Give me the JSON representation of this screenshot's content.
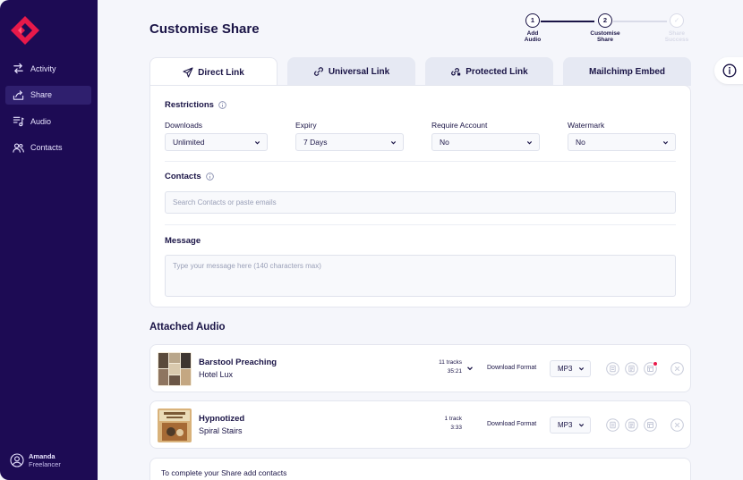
{
  "sidebar": {
    "items": [
      {
        "label": "Activity",
        "icon": "arrows-swap-icon"
      },
      {
        "label": "Share",
        "icon": "share-upload-icon",
        "active": true
      },
      {
        "label": "Audio",
        "icon": "audio-playlist-icon"
      },
      {
        "label": "Contacts",
        "icon": "users-icon"
      }
    ],
    "user": {
      "name": "Amanda",
      "role": "Freelancer"
    },
    "colors": {
      "background": "#1d0b54",
      "active": "#2f1f6e",
      "logo": "#e8194a"
    }
  },
  "header": {
    "title": "Customise Share",
    "steps": [
      {
        "number": "1",
        "label_line1": "Add",
        "label_line2": "Audio",
        "state": "done"
      },
      {
        "number": "2",
        "label_line1": "Customise",
        "label_line2": "Share",
        "state": "current"
      },
      {
        "number": "✓",
        "label_line1": "Share",
        "label_line2": "Success",
        "state": "todo"
      }
    ]
  },
  "tabs": [
    {
      "label": "Direct Link",
      "icon": "paper-plane-icon",
      "active": true
    },
    {
      "label": "Universal Link",
      "icon": "link-icon"
    },
    {
      "label": "Protected Link",
      "icon": "locked-link-icon"
    },
    {
      "label": "Mailchimp Embed",
      "icon": ""
    }
  ],
  "restrictions": {
    "title": "Restrictions",
    "downloads": {
      "label": "Downloads",
      "value": "Unlimited"
    },
    "expiry": {
      "label": "Expiry",
      "value": "7 Days"
    },
    "require_account": {
      "label": "Require Account",
      "value": "No"
    },
    "watermark": {
      "label": "Watermark",
      "value": "No"
    }
  },
  "contacts": {
    "title": "Contacts",
    "placeholder": "Search Contacts or paste emails"
  },
  "message": {
    "title": "Message",
    "placeholder": "Type your message here (140 characters max)"
  },
  "attached": {
    "title": "Attached Audio",
    "items": [
      {
        "title": "Barstool Preaching",
        "artist": "Hotel Lux",
        "tracks": "11 tracks",
        "duration": "35:21",
        "download_label": "Download Format",
        "format": "MP3",
        "expandable": true,
        "notification": true
      },
      {
        "title": "Hypnotized",
        "artist": "Spiral Stairs",
        "tracks": "1 track",
        "duration": "3:33",
        "download_label": "Download Format",
        "format": "MP3",
        "expandable": false,
        "notification": false
      }
    ]
  },
  "footer_note": "To complete your Share add contacts",
  "colors": {
    "primary_text": "#1a1446",
    "accent": "#e8194a",
    "muted": "#9aa0b8"
  }
}
